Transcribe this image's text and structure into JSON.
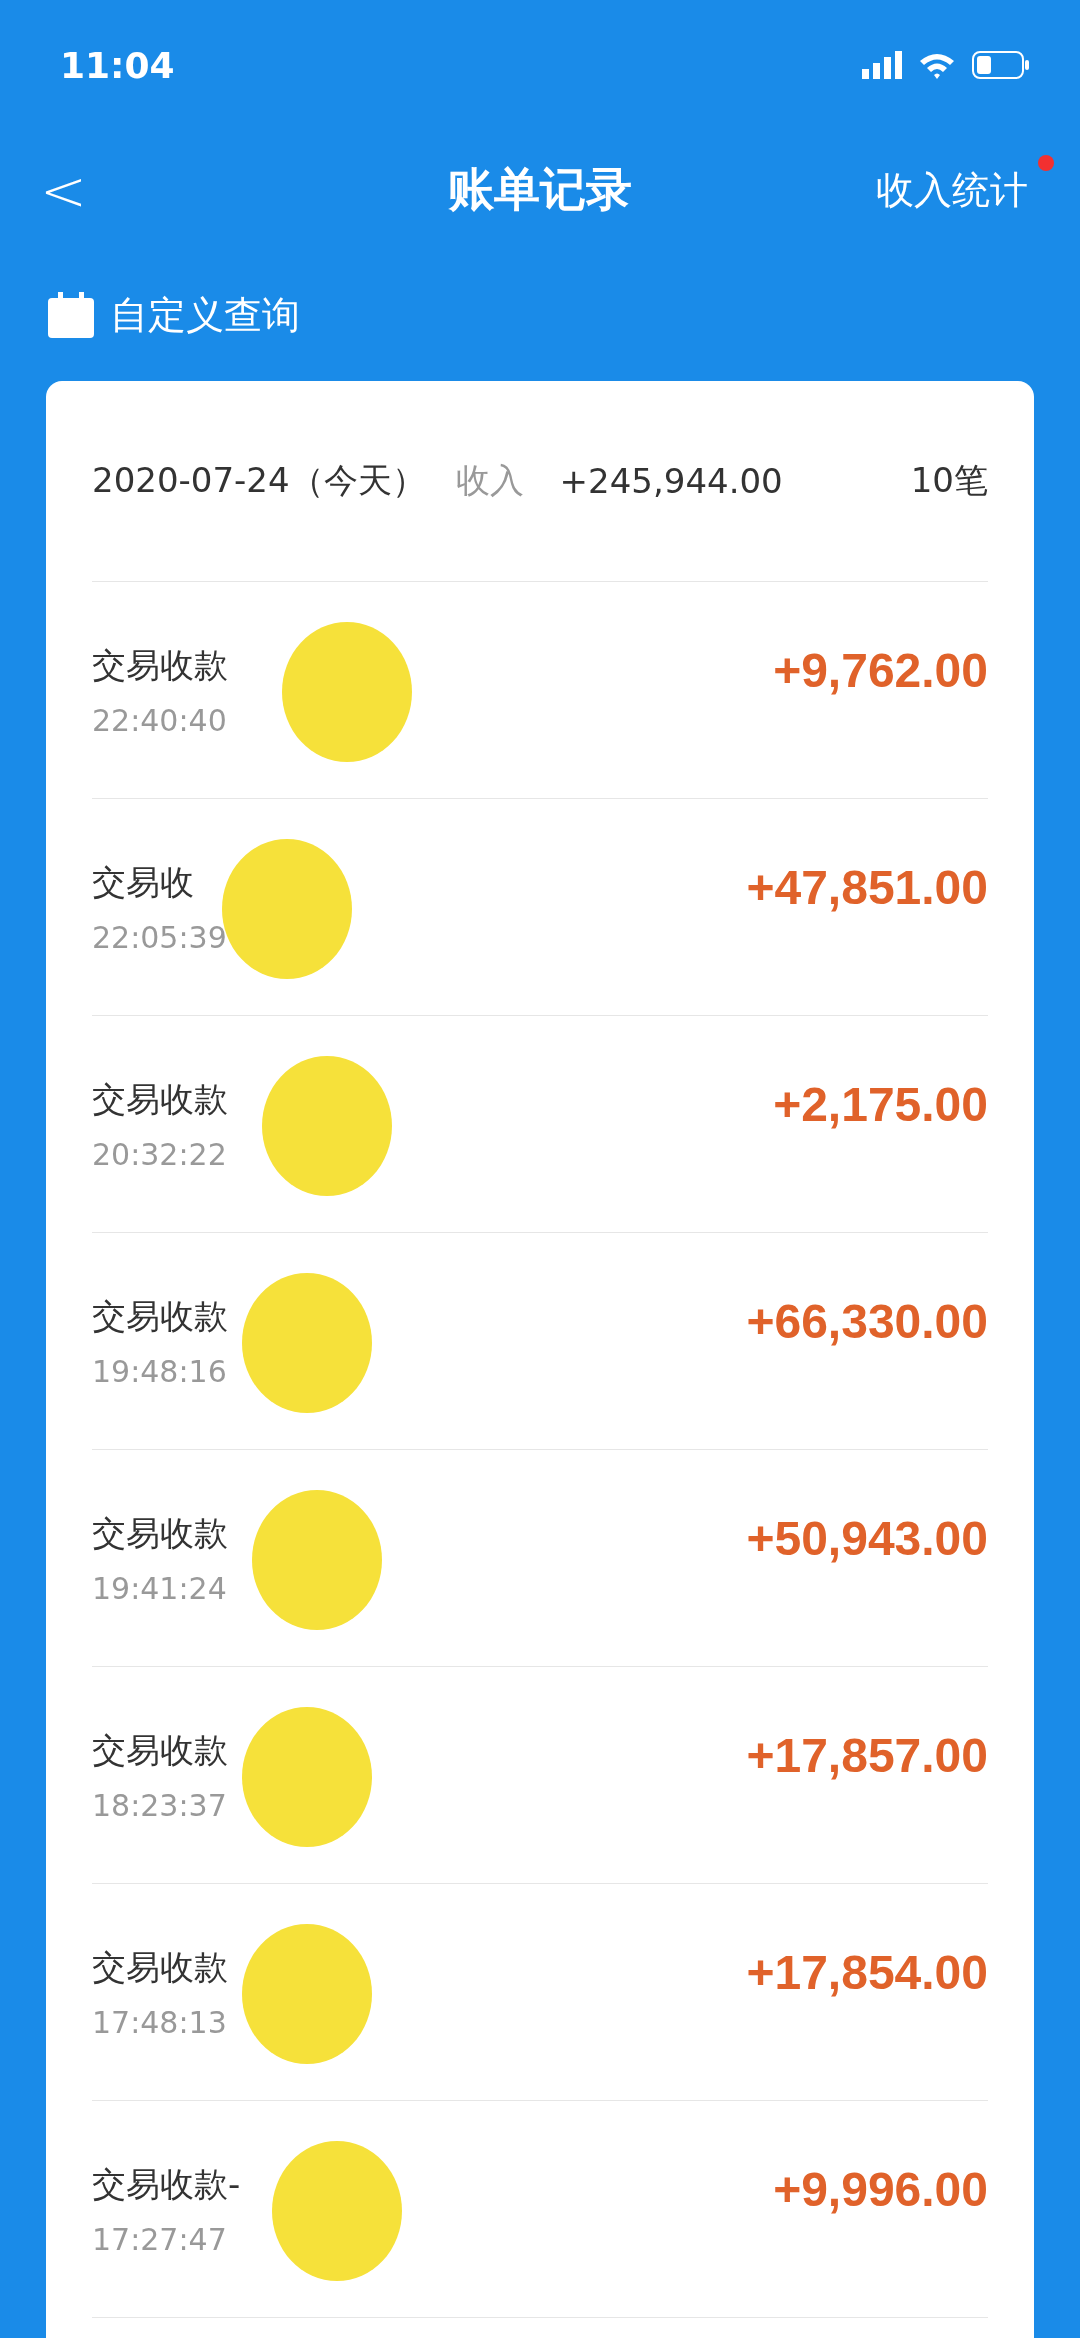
{
  "status_bar": {
    "time": "11:04"
  },
  "nav": {
    "back": "<",
    "title": "账单记录",
    "action": "收入统计",
    "action_badge": true
  },
  "query": {
    "label": "自定义查询"
  },
  "summary": {
    "date": "2020-07-24（今天）",
    "type": "收入",
    "total": "+245,944.00",
    "count": "10笔"
  },
  "records": [
    {
      "title": "交易收款",
      "time": "22:40:40",
      "amount": "+9,762.00",
      "covered": true
    },
    {
      "title": "交易收",
      "time": "22:05:39",
      "amount": "+47,851.00",
      "covered": true
    },
    {
      "title": "交易收款",
      "time": "20:32:22",
      "amount": "+2,175.00",
      "covered": true
    },
    {
      "title": "交易收款",
      "time": "19:48:16",
      "amount": "+66,330.00",
      "covered": true
    },
    {
      "title": "交易收款",
      "time": "19:41:24",
      "amount": "+50,943.00",
      "covered": true
    },
    {
      "title": "交易收款",
      "time": "18:23:37",
      "amount": "+17,857.00",
      "covered": true
    },
    {
      "title": "交易收款",
      "time": "17:48:13",
      "amount": "+17,854.00",
      "covered": true
    },
    {
      "title": "交易收款-",
      "time": "17:27:47",
      "amount": "+9,996.00",
      "covered": true
    }
  ]
}
